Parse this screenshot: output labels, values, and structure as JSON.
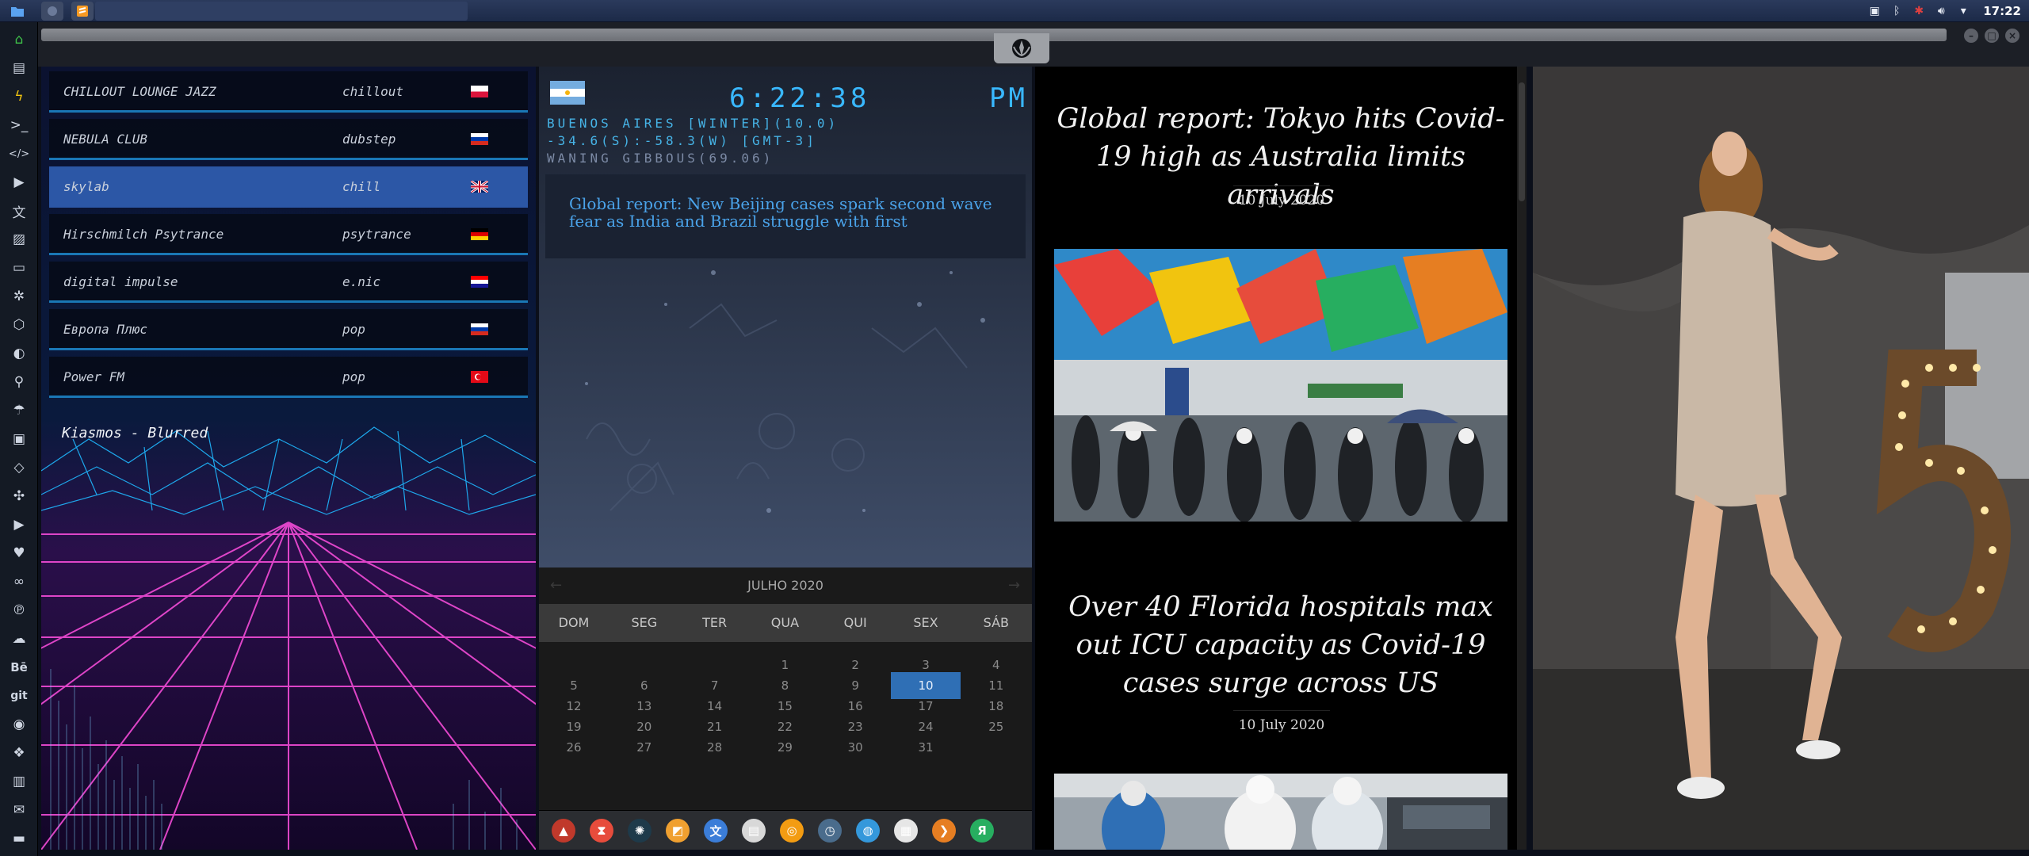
{
  "top_panel": {
    "clock": "17:22"
  },
  "tray": {
    "icons": [
      "screenshot-icon",
      "bluetooth-icon",
      "bug-icon",
      "volume-icon",
      "wifi-icon"
    ]
  },
  "dock": {
    "items": [
      "home-icon",
      "document-icon",
      "lightning-icon",
      "terminal-icon",
      "code-icon",
      "play-icon",
      "translate-icon",
      "image-icon",
      "terminal-window-icon",
      "openai-icon",
      "blender-icon",
      "globe-icon",
      "search-icon",
      "umbrella-icon",
      "contact-icon",
      "tag-icon",
      "puzzle-icon",
      "youtube-icon",
      "heart-icon",
      "infinity-icon",
      "pinterest-icon",
      "cloud-icon",
      "behance-icon",
      "git-icon",
      "github-icon",
      "layers-icon",
      "map-icon",
      "mail-icon",
      "inbox-icon"
    ],
    "behance_label": "Bē",
    "git_label": "git"
  },
  "radio": {
    "stations": [
      {
        "name": "CHILLOUT LOUNGE JAZZ",
        "genre": "chillout",
        "flag": "pl"
      },
      {
        "name": "NEBULA CLUB",
        "genre": "dubstep",
        "flag": "ru"
      },
      {
        "name": "skylab",
        "genre": "chill",
        "flag": "gb",
        "active": true
      },
      {
        "name": "Hirschmilch Psytrance",
        "genre": "psytrance",
        "flag": "de"
      },
      {
        "name": "digital impulse",
        "genre": "e.nic",
        "flag": "hr"
      },
      {
        "name": "Европа Плюс",
        "genre": "pop",
        "flag": "ru"
      },
      {
        "name": "Power FM",
        "genre": "pop",
        "flag": "tr"
      }
    ],
    "now_playing": "Kiasmos - Blurred"
  },
  "world_clock": {
    "time": "6:22:38",
    "ampm": "PM",
    "location": "BUENOS AIRES [WINTER](10.0)",
    "coords": "-34.6(S):-58.3(W) [GMT-3]",
    "moon": "WANING GIBBOUS(69.06)",
    "ticker": "Global report: New Beijing cases spark second wave fear as India and Brazil struggle with first"
  },
  "calendar": {
    "month": "JULHO 2020",
    "weekdays": [
      "DOM",
      "SEG",
      "TER",
      "QUA",
      "QUI",
      "SEX",
      "SÁB"
    ],
    "weeks": [
      [
        "",
        "",
        "",
        "1",
        "2",
        "3",
        "4"
      ],
      [
        "5",
        "6",
        "7",
        "8",
        "9",
        "10",
        "11"
      ],
      [
        "12",
        "13",
        "14",
        "15",
        "16",
        "17",
        "18"
      ],
      [
        "19",
        "20",
        "21",
        "22",
        "23",
        "24",
        "25"
      ],
      [
        "26",
        "27",
        "28",
        "29",
        "30",
        "31",
        ""
      ]
    ],
    "today": "10"
  },
  "app_dock": {
    "apps": [
      {
        "name": "arch-icon",
        "glyph": "▲",
        "color": "#c0392b"
      },
      {
        "name": "hourglass-icon",
        "glyph": "⧗",
        "color": "#e74c3c"
      },
      {
        "name": "system-monitor-icon",
        "glyph": "✺",
        "color": "#1e3a4a"
      },
      {
        "name": "image-viewer-icon",
        "glyph": "◩",
        "color": "#f0a030"
      },
      {
        "name": "translate-app-icon",
        "glyph": "文",
        "color": "#3b7dd8"
      },
      {
        "name": "notes-icon",
        "glyph": "▤",
        "color": "#d8d8d8"
      },
      {
        "name": "search-app-icon",
        "glyph": "◎",
        "color": "#f39c12"
      },
      {
        "name": "clock-app-icon",
        "glyph": "◷",
        "color": "#4a6c8c"
      },
      {
        "name": "browser-icon",
        "glyph": "◍",
        "color": "#3498db"
      },
      {
        "name": "calendar-app-icon",
        "glyph": "▦",
        "color": "#e6e6e6"
      },
      {
        "name": "prompt-icon",
        "glyph": "❯",
        "color": "#e67e22"
      },
      {
        "name": "yandex-icon",
        "glyph": "Я",
        "color": "#27ae60"
      }
    ]
  },
  "news": {
    "articles": [
      {
        "headline": "Global report: Tokyo hits Covid-19 high as Australia limits arrivals",
        "date": "10 July 2020"
      },
      {
        "headline": "Over 40 Florida hospitals max out ICU capacity as Covid-19 cases surge across US",
        "date": "10 July 2020"
      }
    ]
  },
  "colors": {
    "accent_blue": "#39b8ff",
    "active_station": "#2c57a6",
    "today_highlight": "#2f6fb5"
  }
}
